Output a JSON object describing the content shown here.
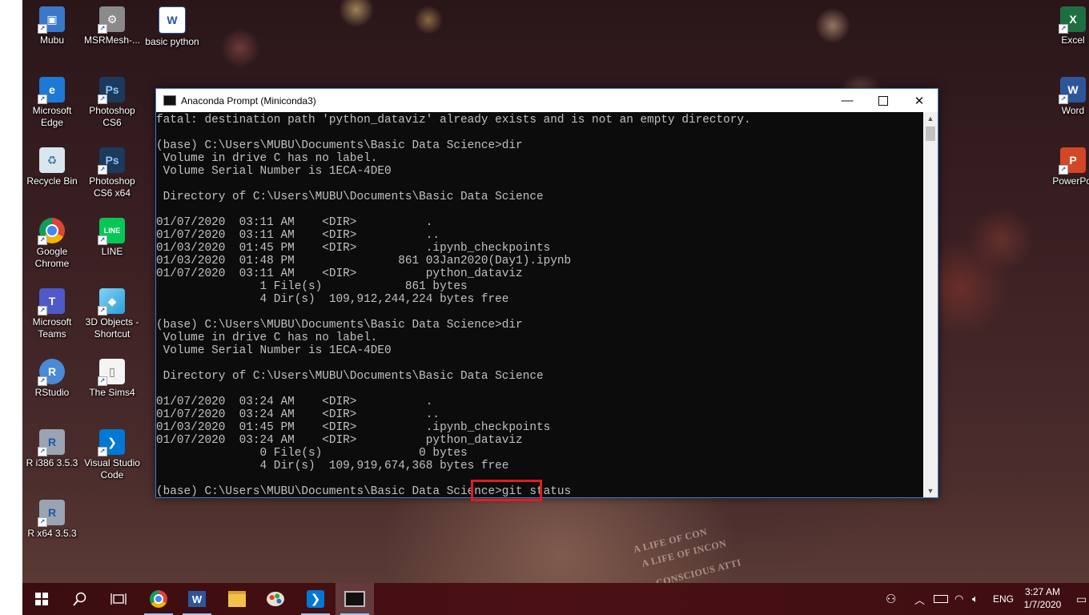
{
  "desktop": {
    "icons_left": [
      {
        "label": "Mubu"
      },
      {
        "label": "MSRMesh-..."
      },
      {
        "label": "basic python"
      },
      {
        "label": "Microsoft Edge"
      },
      {
        "label": "Photoshop CS6"
      },
      {
        "label": "Recycle Bin"
      },
      {
        "label": "Photoshop CS6 x64"
      },
      {
        "label": "Google Chrome"
      },
      {
        "label": "LINE"
      },
      {
        "label": "Microsoft Teams"
      },
      {
        "label": "3D Objects - Shortcut"
      },
      {
        "label": "RStudio"
      },
      {
        "label": "The Sims4"
      },
      {
        "label": "R i386 3.5.3"
      },
      {
        "label": "Visual Studio Code"
      },
      {
        "label": "R x64 3.5.3"
      }
    ],
    "icons_right": [
      {
        "label": "Excel"
      },
      {
        "label": "Word"
      },
      {
        "label": "PowerPoi"
      }
    ],
    "jacket_text": [
      "A LIFE OF CON",
      "A LIFE OF INCON",
      "CONSCIOUS ATTI"
    ]
  },
  "window": {
    "title": "Anaconda Prompt (Miniconda3)",
    "console_lines": [
      "fatal: destination path 'python_dataviz' already exists and is not an empty directory.",
      "",
      "(base) C:\\Users\\MUBU\\Documents\\Basic Data Science>dir",
      " Volume in drive C has no label.",
      " Volume Serial Number is 1ECA-4DE0",
      "",
      " Directory of C:\\Users\\MUBU\\Documents\\Basic Data Science",
      "",
      "01/07/2020  03:11 AM    <DIR>          .",
      "01/07/2020  03:11 AM    <DIR>          ..",
      "01/03/2020  01:45 PM    <DIR>          .ipynb_checkpoints",
      "01/03/2020  01:48 PM               861 03Jan2020(Day1).ipynb",
      "01/07/2020  03:11 AM    <DIR>          python_dataviz",
      "               1 File(s)            861 bytes",
      "               4 Dir(s)  109,912,244,224 bytes free",
      "",
      "(base) C:\\Users\\MUBU\\Documents\\Basic Data Science>dir",
      " Volume in drive C has no label.",
      " Volume Serial Number is 1ECA-4DE0",
      "",
      " Directory of C:\\Users\\MUBU\\Documents\\Basic Data Science",
      "",
      "01/07/2020  03:24 AM    <DIR>          .",
      "01/07/2020  03:24 AM    <DIR>          ..",
      "01/03/2020  01:45 PM    <DIR>          .ipynb_checkpoints",
      "01/07/2020  03:24 AM    <DIR>          python_dataviz",
      "               0 File(s)              0 bytes",
      "               4 Dir(s)  109,919,674,368 bytes free",
      "",
      "(base) C:\\Users\\MUBU\\Documents\\Basic Data Science>git status"
    ]
  },
  "taskbar": {
    "apps": [
      "start",
      "search",
      "task-view",
      "chrome",
      "word",
      "file-explorer",
      "paint",
      "vscode",
      "anaconda-prompt"
    ],
    "tray": {
      "language": "ENG",
      "time": "3:27 AM",
      "date": "1/7/2020"
    }
  },
  "colors": {
    "console_bg": "#0c0c0c",
    "console_text": "#c0c0c0",
    "highlight": "#e01b24",
    "taskbar": "#4a1014"
  }
}
